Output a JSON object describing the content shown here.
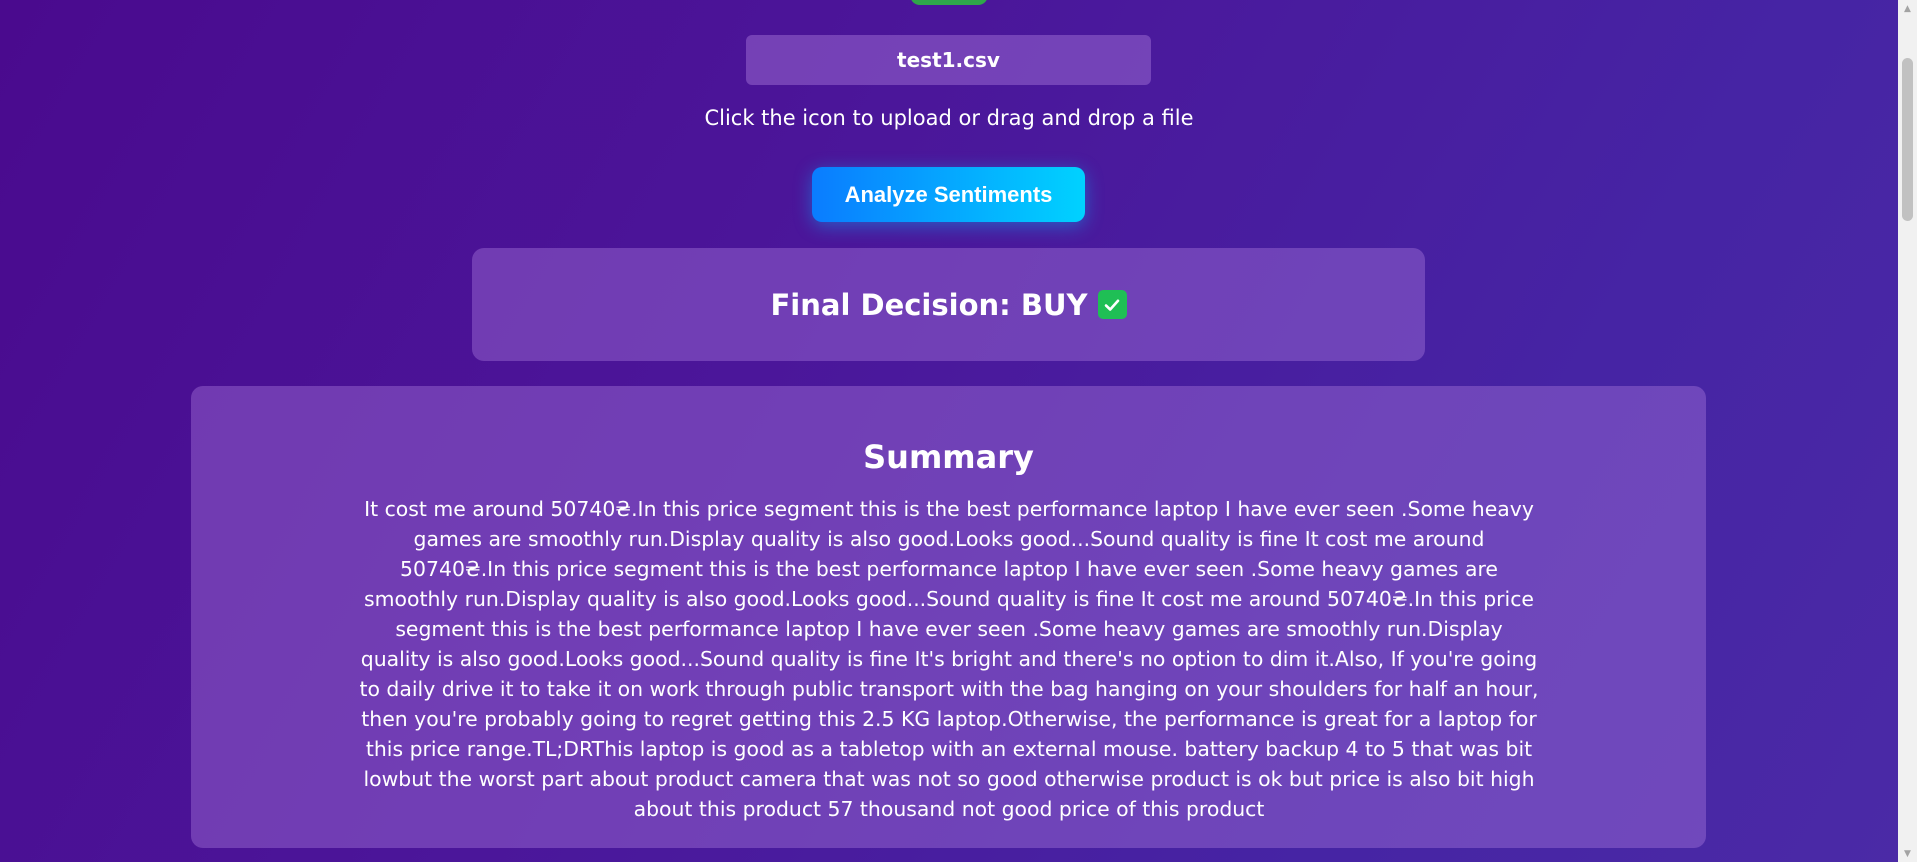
{
  "upload": {
    "file_name": "test1.csv",
    "hint": "Click the icon to upload or drag and drop a file"
  },
  "actions": {
    "analyze_label": "Analyze Sentiments"
  },
  "decision": {
    "text": "Final Decision: BUY",
    "icon": "check-mark-icon",
    "icon_color": "#1fbf55"
  },
  "summary": {
    "title": "Summary",
    "body": "It cost me around 50740₴.In this price segment this is the best performance laptop I have ever seen .Some heavy games are smoothly run.Display quality is also good.Looks good...Sound quality is fine It cost me around 50740₴.In this price segment this is the best performance laptop I have ever seen .Some heavy games are smoothly run.Display quality is also good.Looks good...Sound quality is fine It cost me around 50740₴.In this price segment this is the best performance laptop I have ever seen .Some heavy games are smoothly run.Display quality is also good.Looks good...Sound quality is fine It's bright and there's no option to dim it.Also, If you're going to daily drive it to take it on work through public transport with the bag hanging on your shoulders for half an hour, then you're probably going to regret getting this 2.5 KG laptop.Otherwise, the performance is great for a laptop for this price range.TL;DRThis laptop is good as a tabletop with an external mouse. battery backup 4 to 5 that was bit lowbut the worst part about product camera that was not so good otherwise product is ok but price is also bit high about this product 57 thousand not good price of this product"
  },
  "theme": {
    "background_start": "#4a0a8e",
    "background_end": "#4b2aa6",
    "button_gradient_start": "#0a7cff",
    "button_gradient_end": "#00d2ff",
    "upload_icon_color": "#2fa64a"
  }
}
